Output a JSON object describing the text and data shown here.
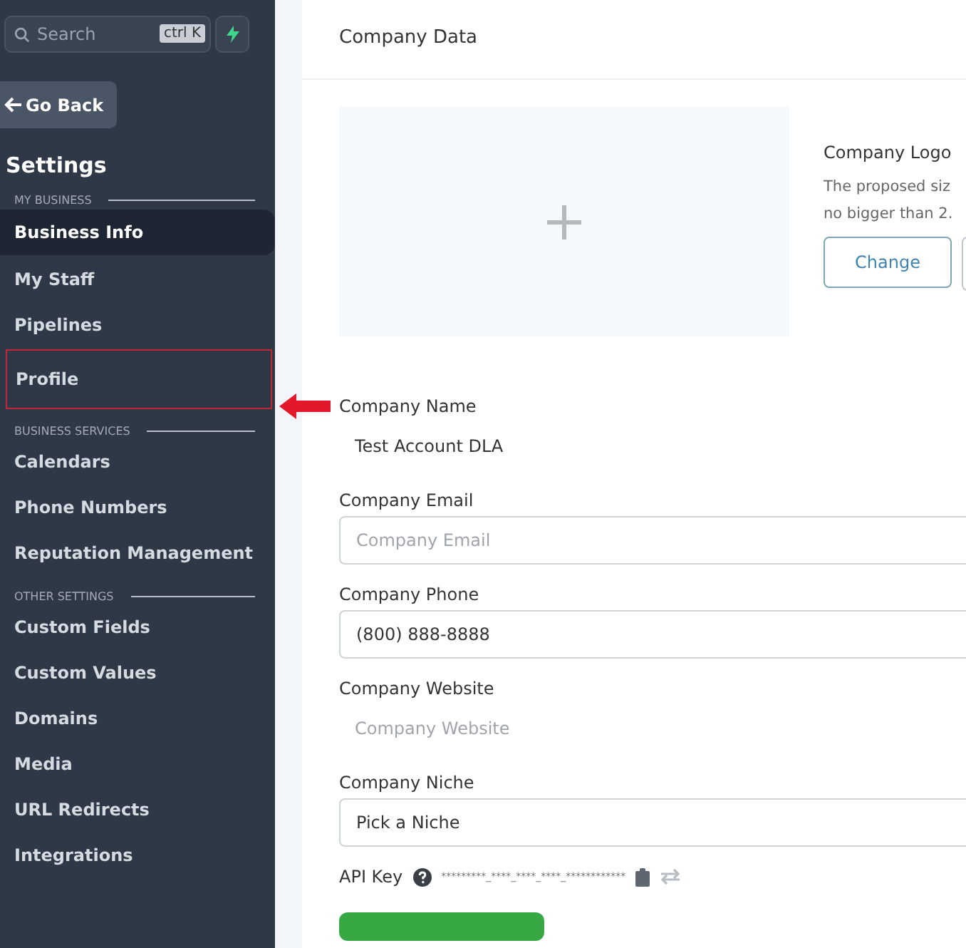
{
  "sidebar": {
    "search": {
      "placeholder": "Search",
      "shortcut": "ctrl K"
    },
    "back_button": "Go Back",
    "title": "Settings",
    "sections": [
      {
        "heading": "MY BUSINESS",
        "items": [
          {
            "label": "Business Info",
            "selected": true,
            "highlighted": false
          },
          {
            "label": "My Staff",
            "selected": false,
            "highlighted": false
          },
          {
            "label": "Pipelines",
            "selected": false,
            "highlighted": false
          },
          {
            "label": "Profile",
            "selected": false,
            "highlighted": true
          }
        ]
      },
      {
        "heading": "BUSINESS SERVICES",
        "items": [
          {
            "label": "Calendars",
            "selected": false,
            "highlighted": false
          },
          {
            "label": "Phone Numbers",
            "selected": false,
            "highlighted": false
          },
          {
            "label": "Reputation Management",
            "selected": false,
            "highlighted": false
          }
        ]
      },
      {
        "heading": "OTHER SETTINGS",
        "items": [
          {
            "label": "Custom Fields",
            "selected": false,
            "highlighted": false
          },
          {
            "label": "Custom Values",
            "selected": false,
            "highlighted": false
          },
          {
            "label": "Domains",
            "selected": false,
            "highlighted": false
          },
          {
            "label": "Media",
            "selected": false,
            "highlighted": false
          },
          {
            "label": "URL Redirects",
            "selected": false,
            "highlighted": false
          },
          {
            "label": "Integrations",
            "selected": false,
            "highlighted": false
          }
        ]
      }
    ]
  },
  "main": {
    "title": "Company Data",
    "logo": {
      "label": "Company Logo",
      "hint_lines": [
        "The proposed siz",
        "no bigger than 2."
      ],
      "button": "Change"
    },
    "fields": [
      {
        "label": "Company Name",
        "value": "Test Account DLA",
        "bordered": false,
        "annotated": true
      },
      {
        "label": "Company Email",
        "placeholder": "Company Email",
        "bordered": true,
        "annotated": false
      },
      {
        "label": "Company Phone",
        "value": "(800) 888-8888",
        "bordered": true,
        "annotated": false
      },
      {
        "label": "Company Website",
        "placeholder": "Company Website",
        "bordered": false,
        "annotated": false
      },
      {
        "label": "Company Niche",
        "value": "Pick a Niche",
        "bordered": true,
        "annotated": false
      }
    ],
    "api_key": {
      "label": "API Key",
      "value": "*********_****_****_****_************"
    }
  }
}
